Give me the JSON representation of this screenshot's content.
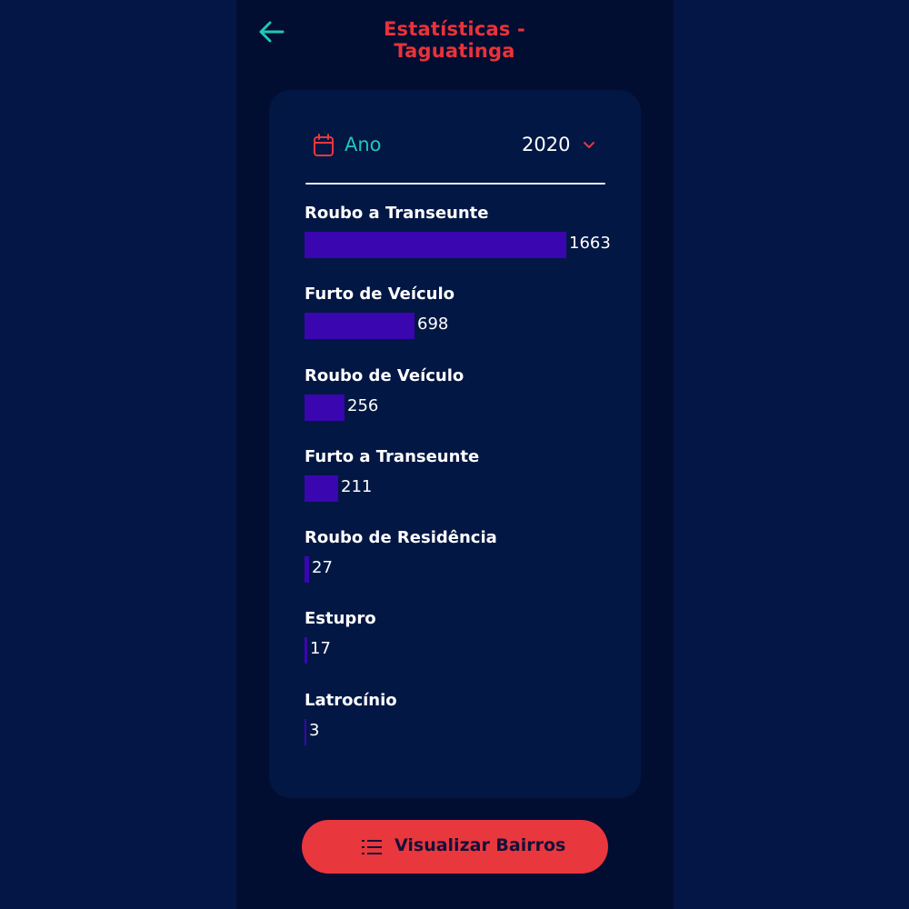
{
  "header": {
    "title": "Estatísticas - Taguatinga",
    "back_icon": "arrow-left-icon"
  },
  "filter": {
    "label": "Ano",
    "icon": "calendar-icon",
    "selected_year": "2020",
    "dropdown_icon": "chevron-down-icon"
  },
  "stats": [
    {
      "label": "Roubo a Transeunte",
      "value": 1663
    },
    {
      "label": "Furto de Veículo",
      "value": 698
    },
    {
      "label": "Roubo de Veículo",
      "value": 256
    },
    {
      "label": "Furto a Transeunte",
      "value": 211
    },
    {
      "label": "Roubo de Residência",
      "value": 27
    },
    {
      "label": "Estupro",
      "value": 17
    },
    {
      "label": "Latrocínio",
      "value": 3
    }
  ],
  "cta": {
    "label": "Visualizar Bairros",
    "icon": "list-icon"
  },
  "colors": {
    "accent_red": "#e8373d",
    "accent_teal": "#20c7b8",
    "bar": "#3a06b0",
    "card": "#031744",
    "background": "#041645"
  }
}
